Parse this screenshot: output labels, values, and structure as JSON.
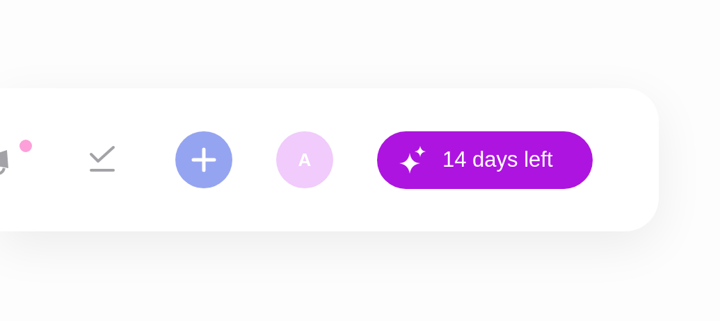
{
  "toolbar": {
    "announcements": {
      "unread": true
    },
    "avatar": {
      "initial": "A"
    },
    "trial_button": {
      "label": "14 days left"
    }
  }
}
